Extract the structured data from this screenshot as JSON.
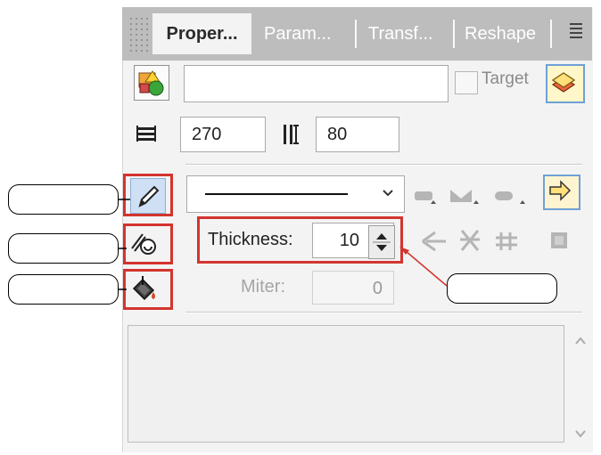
{
  "tabs": [
    {
      "label": "Proper...",
      "active": true
    },
    {
      "label": "Param...",
      "active": false
    },
    {
      "label": "Transf...",
      "active": false
    },
    {
      "label": "Reshape",
      "active": false
    }
  ],
  "object": {
    "name_value": "",
    "target_label": "Target",
    "target_checked": false
  },
  "size": {
    "width_value": "270",
    "height_value": "80"
  },
  "stroke": {
    "thickness_label": "Thickness:",
    "thickness_value": "10",
    "miter_label": "Miter:",
    "miter_value": "0"
  },
  "callouts": [
    "",
    "",
    "",
    ""
  ],
  "colors": {
    "highlight_red": "#d3342f",
    "tab_bar": "#bdbdbd",
    "panel_bg": "#f3f3f3",
    "selected_border": "#6fa0d6"
  },
  "icons": [
    "shape-fill-icon",
    "target-layer-icon",
    "width-icon",
    "height-icon",
    "pen-icon",
    "line-style-icon",
    "fill-bucket-icon",
    "dropdown-chevron-icon",
    "line-cap-icons",
    "line-join-icons",
    "spin-arrows-icon",
    "panel-menu-icon"
  ]
}
